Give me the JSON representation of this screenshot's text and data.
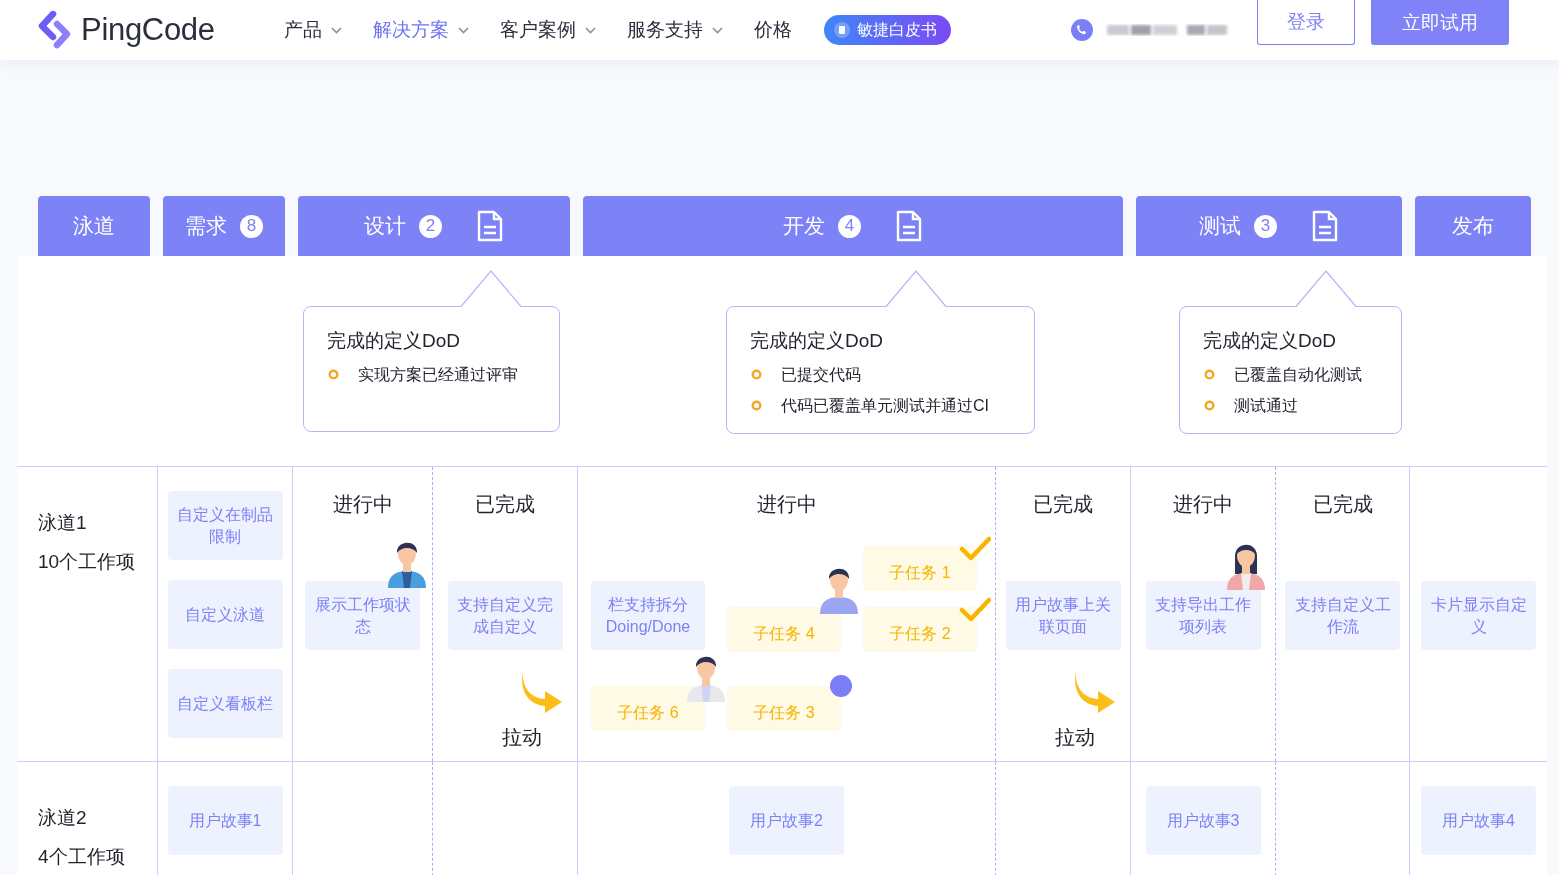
{
  "header": {
    "logo": "PingCode",
    "nav": [
      {
        "label": "产品",
        "selected": false,
        "dropdown": true
      },
      {
        "label": "解决方案",
        "selected": true,
        "dropdown": true
      },
      {
        "label": "客户案例",
        "selected": false,
        "dropdown": true
      },
      {
        "label": "服务支持",
        "selected": false,
        "dropdown": true
      },
      {
        "label": "价格",
        "selected": false,
        "dropdown": false
      }
    ],
    "whitepaper": "敏捷白皮书",
    "login": "登录",
    "trial": "立即试用"
  },
  "stages": [
    {
      "label": "泳道",
      "split": false,
      "doc": false
    },
    {
      "label": "需求",
      "count": "8",
      "split": false,
      "doc": false
    },
    {
      "label": "设计",
      "count": "2",
      "split": true,
      "doc": true,
      "dod": {
        "title": "完成的定义DoD",
        "items": [
          "实现方案已经通过评审"
        ]
      }
    },
    {
      "label": "开发",
      "count": "4",
      "split": true,
      "doc": true,
      "dod": {
        "title": "完成的定义DoD",
        "items": [
          "已提交代码",
          "代码已覆盖单元测试并通过CI"
        ]
      }
    },
    {
      "label": "测试",
      "count": "3",
      "split": true,
      "doc": true,
      "dod": {
        "title": "完成的定义DoD",
        "items": [
          "已覆盖自动化测试",
          "测试通过"
        ]
      }
    },
    {
      "label": "发布",
      "split": false,
      "doc": false
    }
  ],
  "lanes": [
    {
      "name": "泳道1",
      "summary": "10个工作项",
      "cells": [
        {
          "cards": [
            {
              "kind": "story",
              "text": "自定义在制品限制"
            },
            {
              "kind": "story",
              "text": "自定义泳道"
            },
            {
              "kind": "story",
              "text": "自定义看板栏"
            }
          ]
        },
        {
          "header": "进行中",
          "cards": [
            {
              "kind": "story",
              "text": "展示工作项状态"
            }
          ]
        },
        {
          "header": "已完成",
          "cards": [
            {
              "kind": "story",
              "text": "支持自定义完成自定义"
            }
          ],
          "pull": "拉动"
        },
        {
          "header": "进行中",
          "cards": [
            {
              "kind": "subtask",
              "text": "子任务 1",
              "done": true,
              "flagged": false
            },
            {
              "kind": "story",
              "text": "栏支持拆分 Doing/Done"
            },
            {
              "kind": "subtask",
              "text": "子任务 4",
              "done": false,
              "flagged": false
            },
            {
              "kind": "subtask",
              "text": "子任务 2",
              "done": true,
              "flagged": false
            },
            {
              "kind": "subtask",
              "text": "子任务 6",
              "done": false,
              "flagged": false
            },
            {
              "kind": "subtask",
              "text": "子任务 3",
              "done": false,
              "flagged": true
            }
          ]
        },
        {
          "header": "已完成",
          "cards": [
            {
              "kind": "story",
              "text": "用户故事上关联页面"
            }
          ],
          "pull": "拉动"
        },
        {
          "header": "进行中",
          "cards": [
            {
              "kind": "story",
              "text": "支持导出工作项列表"
            }
          ]
        },
        {
          "header": "已完成",
          "cards": [
            {
              "kind": "story",
              "text": "支持自定义工作流"
            }
          ]
        },
        {
          "cards": [
            {
              "kind": "story",
              "text": "卡片显示自定义"
            }
          ]
        }
      ]
    },
    {
      "name": "泳道2",
      "summary": "4个工作项",
      "cells": [
        {
          "cards": [
            {
              "kind": "story",
              "text": "用户故事1"
            }
          ]
        },
        {},
        {},
        {
          "cards": [
            {
              "kind": "story",
              "text": "用户故事2"
            }
          ]
        },
        {},
        {
          "cards": [
            {
              "kind": "story",
              "text": "用户故事3"
            }
          ]
        },
        {},
        {
          "cards": [
            {
              "kind": "story",
              "text": "用户故事4"
            }
          ]
        }
      ]
    }
  ]
}
